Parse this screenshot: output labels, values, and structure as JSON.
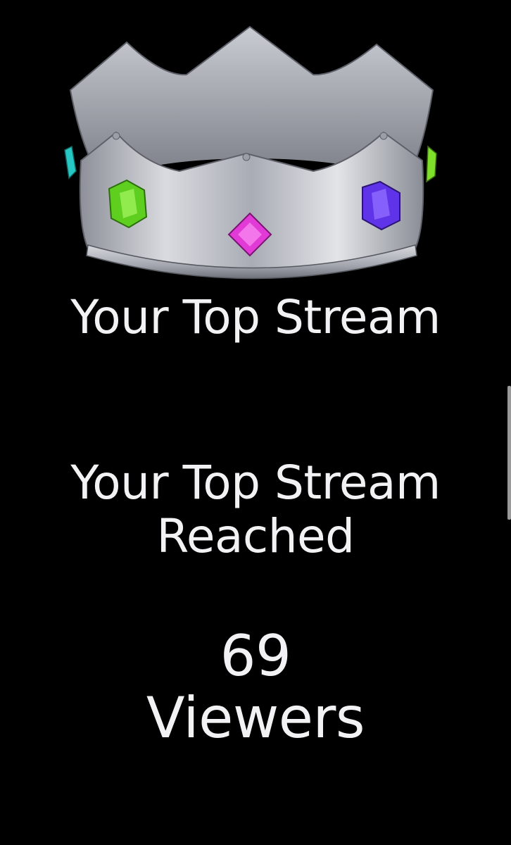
{
  "recap": {
    "title": "Your Top Stream",
    "subtitle_line1": "Your Top Stream",
    "subtitle_line2": "Reached",
    "viewer_count": "69",
    "viewer_unit": "Viewers"
  },
  "icons": {
    "crown": "crown-icon",
    "gems": [
      "green-gem",
      "magenta-gem",
      "purple-gem",
      "teal-gem",
      "lime-gem"
    ]
  },
  "colors": {
    "background": "#000000",
    "text": "#f2f2f4",
    "crown_silver": "#b9bcc4",
    "gem_green": "#6fdc28",
    "gem_magenta": "#e63ad8",
    "gem_purple": "#6a3df0",
    "gem_teal": "#27c7c4"
  }
}
